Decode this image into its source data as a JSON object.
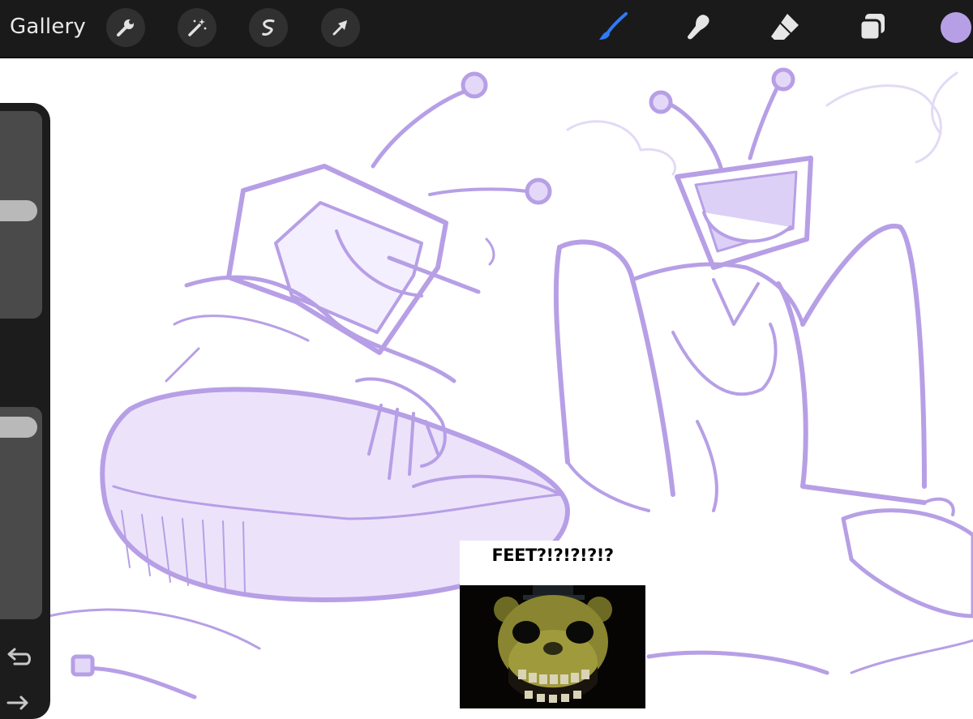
{
  "toolbar": {
    "gallery_label": "Gallery",
    "left_tools": [
      "wrench-icon",
      "magic-wand-icon",
      "selection-icon",
      "transform-arrow-icon"
    ],
    "right_tools": [
      "brush-icon",
      "smudge-icon",
      "eraser-icon",
      "layers-icon"
    ],
    "active_tool": "brush-icon",
    "active_tool_color": "#2e7bf6",
    "current_color": "#b79fe6"
  },
  "sidebar": {
    "brush_size_slider": "brush-size",
    "opacity_slider": "opacity",
    "modify_button": "modify-square",
    "undo_icon": "undo-icon",
    "redo_icon": "redo-icon"
  },
  "canvas": {
    "sketch_color": "#b79fe6"
  },
  "meme": {
    "caption": "FEET?!?!?!?!?"
  }
}
